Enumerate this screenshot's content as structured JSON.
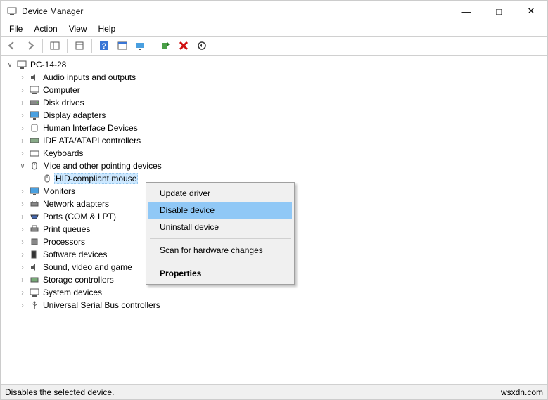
{
  "window": {
    "title": "Device Manager"
  },
  "menu": {
    "file": "File",
    "action": "Action",
    "view": "View",
    "help": "Help"
  },
  "tree": {
    "root": "PC-14-28",
    "items": [
      "Audio inputs and outputs",
      "Computer",
      "Disk drives",
      "Display adapters",
      "Human Interface Devices",
      "IDE ATA/ATAPI controllers",
      "Keyboards",
      "Mice and other pointing devices",
      "Monitors",
      "Network adapters",
      "Ports (COM & LPT)",
      "Print queues",
      "Processors",
      "Software devices",
      "Sound, video and game",
      "Storage controllers",
      "System devices",
      "Universal Serial Bus controllers"
    ],
    "child": "HID-compliant mouse"
  },
  "context_menu": {
    "update": "Update driver",
    "disable": "Disable device",
    "uninstall": "Uninstall device",
    "scan": "Scan for hardware changes",
    "properties": "Properties"
  },
  "status": {
    "text": "Disables the selected device.",
    "source": "wsxdn.com"
  }
}
